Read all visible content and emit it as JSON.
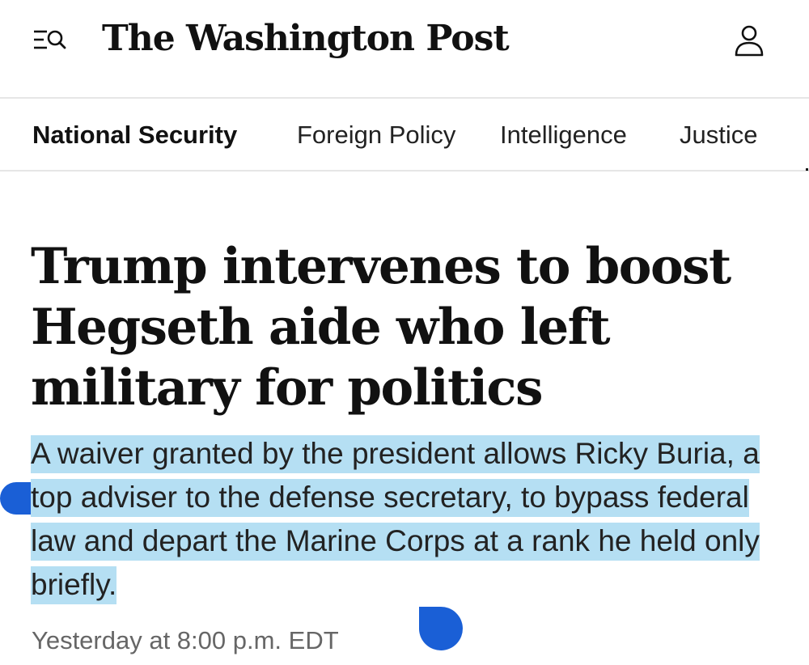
{
  "header": {
    "logo_text": "The Washington Post",
    "menu_icon": "menu-search-icon",
    "account_icon": "user-account-icon"
  },
  "nav": {
    "items": [
      {
        "label": "National Security",
        "active": true
      },
      {
        "label": "Foreign Policy",
        "active": false
      },
      {
        "label": "Intelligence",
        "active": false
      },
      {
        "label": "Justice",
        "active": false
      }
    ]
  },
  "article": {
    "headline": "Trump intervenes to boost Hegseth aide who left military for politics",
    "dek": "A waiver granted by the president allows Ricky Buria, a top adviser to the defense secretary, to bypass federal law and depart the Marine Corps at a rank he held only briefly.",
    "timestamp": "Yesterday at 8:00 p.m. EDT"
  },
  "selection": {
    "highlight_color": "#b5dff3",
    "handle_color": "#1a5fd6"
  }
}
